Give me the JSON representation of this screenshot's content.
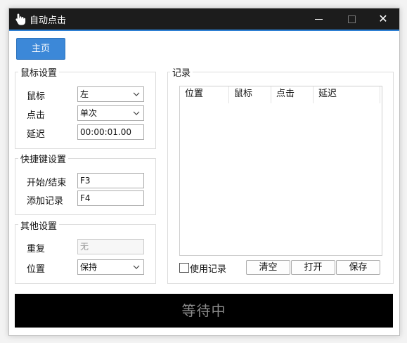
{
  "window": {
    "title": "自动点击"
  },
  "toolbar": {
    "home_label": "主页"
  },
  "mouse_settings": {
    "title": "鼠标设置",
    "mouse_label": "鼠标",
    "mouse_value": "左",
    "click_label": "点击",
    "click_value": "单次",
    "delay_label": "延迟",
    "delay_value": "00:00:01.00"
  },
  "hotkey_settings": {
    "title": "快捷键设置",
    "start_stop_label": "开始/结束",
    "start_stop_value": "F3",
    "add_record_label": "添加记录",
    "add_record_value": "F4"
  },
  "other_settings": {
    "title": "其他设置",
    "repeat_label": "重复",
    "repeat_placeholder": "无",
    "position_label": "位置",
    "position_value": "保持"
  },
  "records": {
    "title": "记录",
    "columns": [
      "位置",
      "鼠标",
      "点击",
      "延迟"
    ],
    "use_records_label": "使用记录",
    "clear_label": "清空",
    "open_label": "打开",
    "save_label": "保存"
  },
  "status": {
    "text": "等待中"
  }
}
